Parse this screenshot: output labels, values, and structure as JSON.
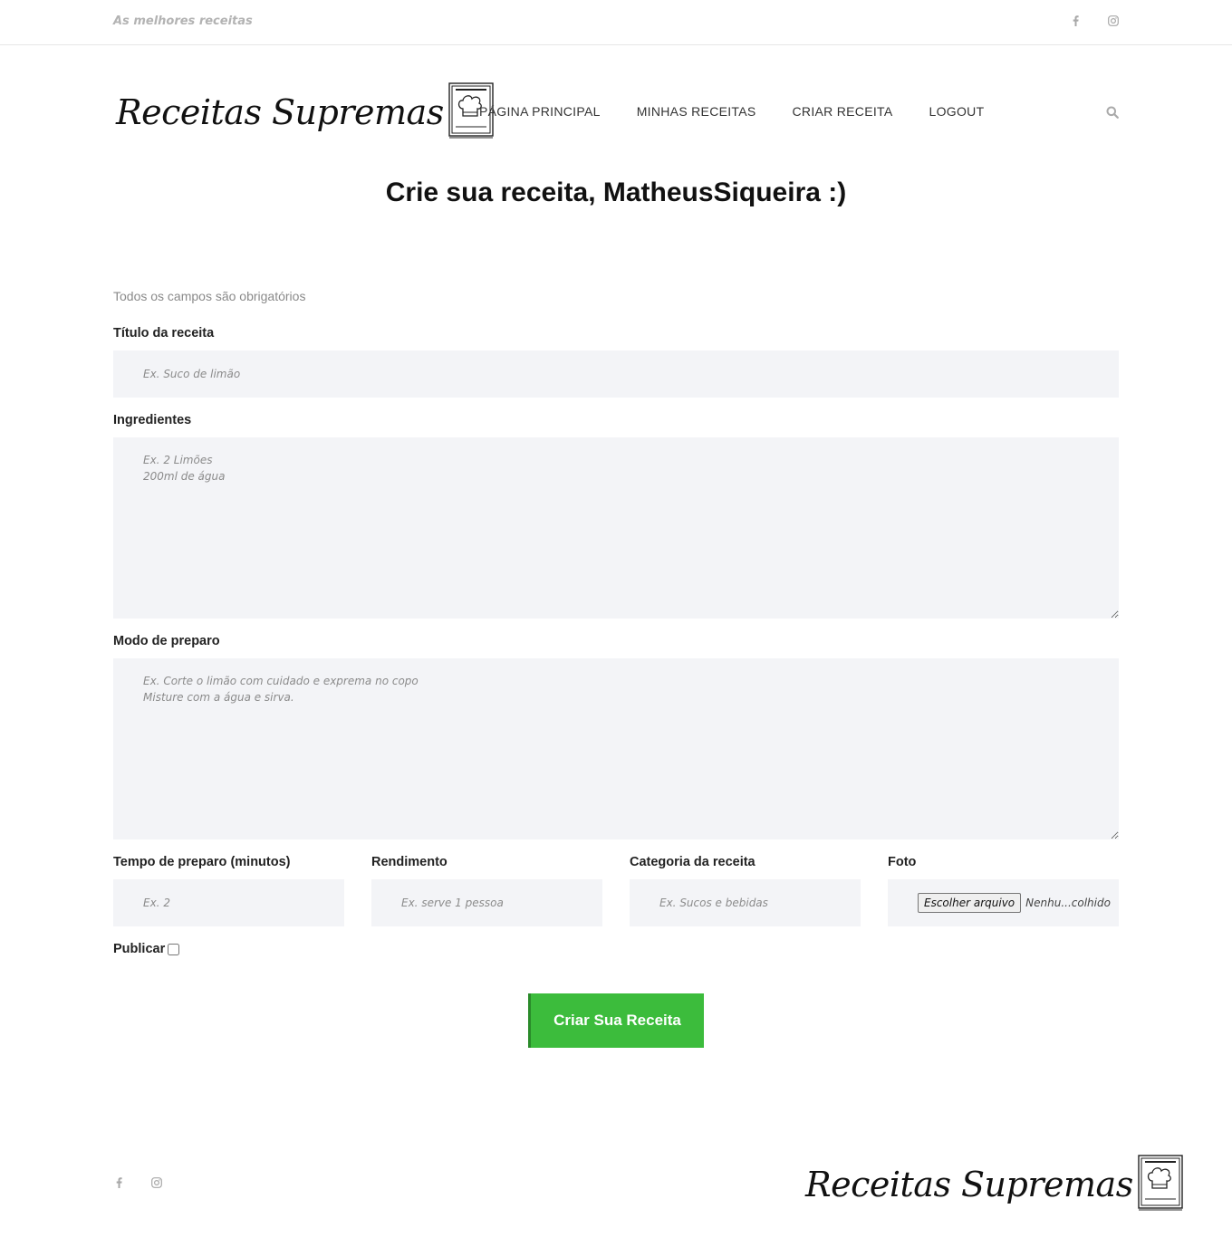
{
  "topbar": {
    "tagline": "As melhores receitas",
    "social": [
      {
        "icon": "facebook-icon",
        "glyph": "f"
      },
      {
        "icon": "instagram-icon",
        "glyph": "◎"
      }
    ]
  },
  "header": {
    "logo_text": "Receitas Supremas",
    "nav": [
      {
        "label": "PÁGINA PRINCIPAL"
      },
      {
        "label": "MINHAS RECEITAS"
      },
      {
        "label": "CRIAR RECEITA"
      },
      {
        "label": "LOGOUT"
      }
    ],
    "search_icon": "search-icon"
  },
  "page": {
    "title": "Crie sua receita, MatheusSiqueira :)",
    "note": "Todos os campos são obrigatórios"
  },
  "form": {
    "titulo": {
      "label": "Título da receita",
      "placeholder": "Ex. Suco de limão",
      "value": ""
    },
    "ingredientes": {
      "label": "Ingredientes",
      "placeholder": "Ex. 2 Limões\n200ml de água",
      "value": ""
    },
    "modo": {
      "label": "Modo de preparo",
      "placeholder": "Ex. Corte o limão com cuidado e exprema no copo\nMisture com a água e sirva.",
      "value": ""
    },
    "tempo": {
      "label": "Tempo de preparo (minutos)",
      "placeholder": "Ex. 2",
      "value": ""
    },
    "rendimento": {
      "label": "Rendimento",
      "placeholder": "Ex. serve 1 pessoa",
      "value": ""
    },
    "categoria": {
      "label": "Categoria da receita",
      "placeholder": "Ex. Sucos e bebidas",
      "value": ""
    },
    "foto": {
      "label": "Foto",
      "button": "Escolher arquivo",
      "file_name": "Nenhu...colhido"
    },
    "publicar": {
      "label": "Publicar",
      "checked": false
    },
    "submit": "Criar Sua Receita"
  },
  "footer": {
    "logo_text": "Receitas Supremas"
  },
  "colors": {
    "accent": "#3cbc3c",
    "field_bg": "#f3f4f7",
    "muted": "#b3b3b3"
  }
}
